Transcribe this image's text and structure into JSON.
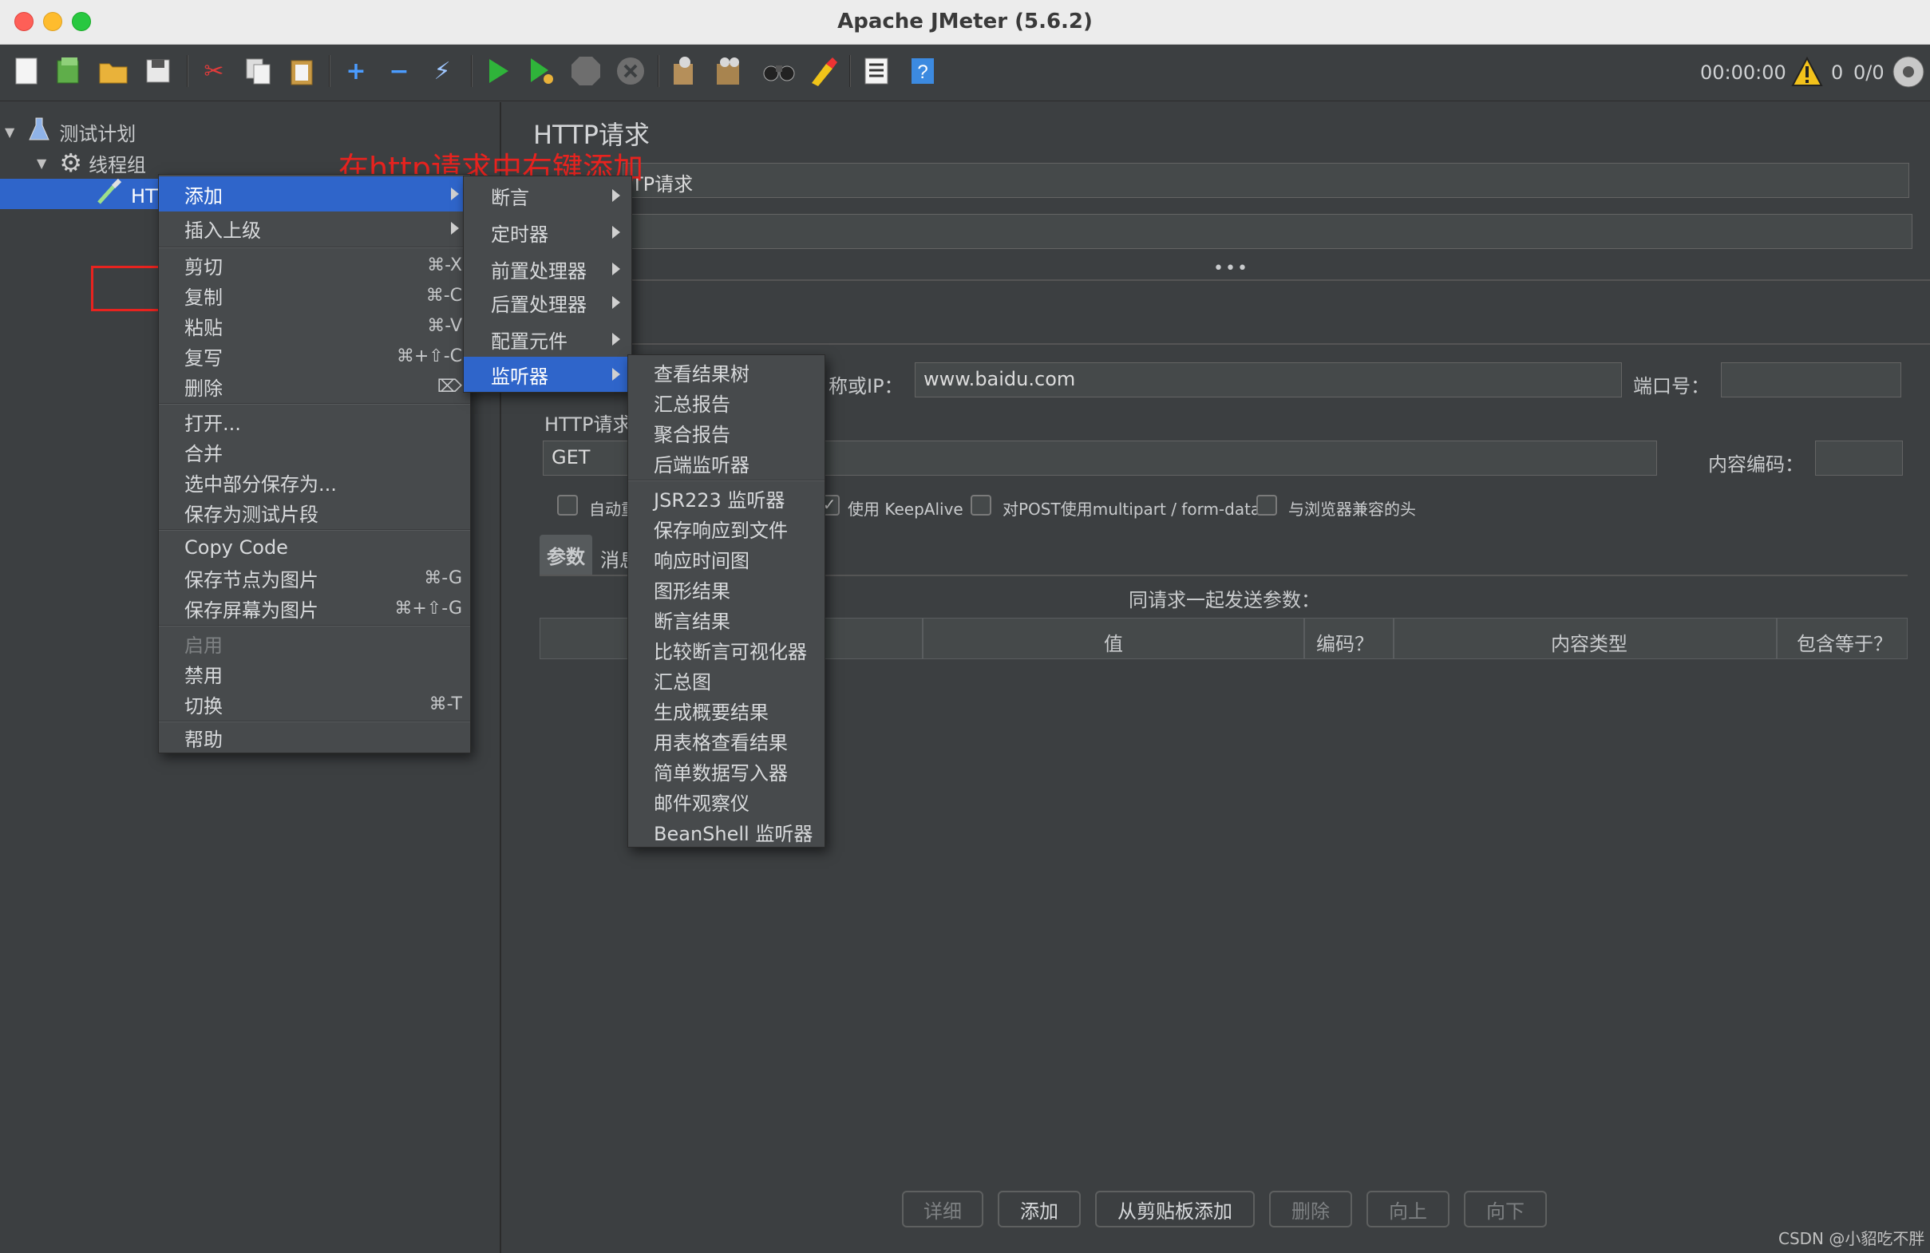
{
  "window": {
    "title": "Apache JMeter (5.6.2)"
  },
  "toolbar": {
    "timer": "00:00:00",
    "warn_count": "0",
    "threads": "0/0"
  },
  "tree": {
    "root": "测试计划",
    "thread_group": "线程组",
    "http_request": "HTTP请求"
  },
  "annotation": "在http请求中右键添加",
  "context_menu": {
    "items": [
      {
        "label": "添加",
        "submenu": true
      },
      {
        "label": "插入上级",
        "submenu": true
      },
      {
        "label": "剪切",
        "shortcut": "⌘-X"
      },
      {
        "label": "复制",
        "shortcut": "⌘-C"
      },
      {
        "label": "粘贴",
        "shortcut": "⌘-V"
      },
      {
        "label": "复写",
        "shortcut": "⌘+⇧-C"
      },
      {
        "label": "删除",
        "shortcut": "⌦"
      },
      {
        "label": "打开..."
      },
      {
        "label": "合并"
      },
      {
        "label": "选中部分保存为..."
      },
      {
        "label": "保存为测试片段"
      },
      {
        "label": "Copy Code"
      },
      {
        "label": "保存节点为图片",
        "shortcut": "⌘-G"
      },
      {
        "label": "保存屏幕为图片",
        "shortcut": "⌘+⇧-G"
      },
      {
        "label": "启用",
        "disabled": true
      },
      {
        "label": "禁用"
      },
      {
        "label": "切换",
        "shortcut": "⌘-T"
      },
      {
        "label": "帮助"
      }
    ]
  },
  "add_submenu": {
    "items": [
      "断言",
      "定时器",
      "前置处理器",
      "后置处理器",
      "配置元件",
      "监听器"
    ]
  },
  "listener_submenu": {
    "items": [
      "查看结果树",
      "汇总报告",
      "聚合报告",
      "后端监听器",
      "JSR223 监听器",
      "保存响应到文件",
      "响应时间图",
      "图形结果",
      "断言结果",
      "比较断言可视化器",
      "汇总图",
      "生成概要结果",
      "用表格查看结果",
      "简单数据写入器",
      "邮件观察仪",
      "BeanShell 监听器"
    ]
  },
  "panel": {
    "title": "HTTP请求",
    "name_value": "TP请求",
    "server_label": "称或IP：",
    "server_value": "www.baidu.com",
    "port_label": "端口号：",
    "http_label": "HTTP请求",
    "method_value": "GET",
    "encoding_label": "内容编码：",
    "chk_auto": "自动重",
    "chk_keepalive": "使用 KeepAlive",
    "chk_multipart": "对POST使用multipart / form-data",
    "chk_browser": "与浏览器兼容的头",
    "tab_params": "参数",
    "tab_body": "消息",
    "params_caption": "同请求一起发送参数：",
    "columns": [
      "值",
      "编码？",
      "内容类型",
      "包含等于？"
    ],
    "buttons": [
      "详细",
      "添加",
      "从剪贴板添加",
      "删除",
      "向上",
      "向下"
    ]
  },
  "watermark": "CSDN @小貂吃不胖",
  "colors": {
    "accent": "#2f65ca",
    "annotation": "#e8231f",
    "background": "#3c3f41"
  }
}
